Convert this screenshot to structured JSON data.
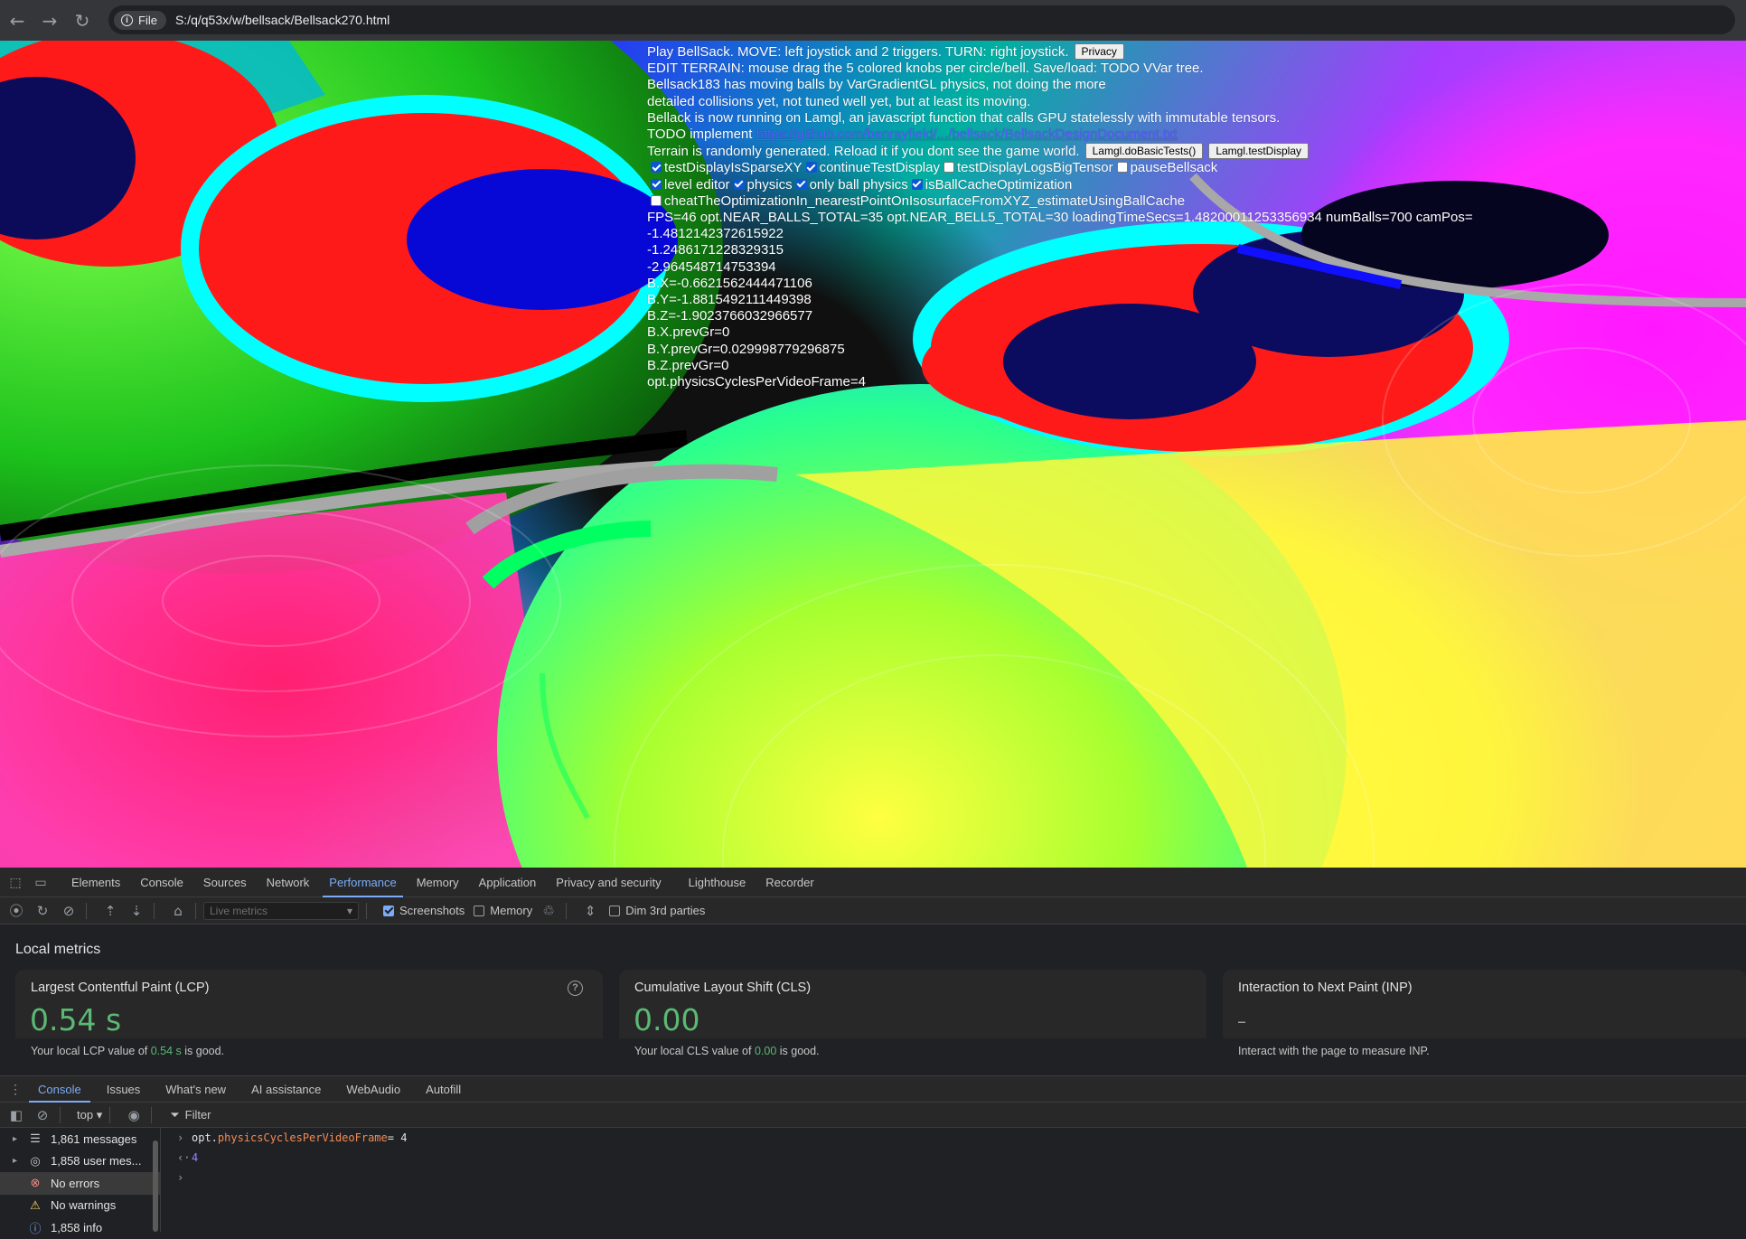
{
  "browser": {
    "back_icon": "back-arrow-icon",
    "forward_icon": "forward-arrow-icon",
    "reload_icon": "reload-icon",
    "chip_label": "File",
    "url": "S:/q/q53x/w/bellsack/Bellsack270.html"
  },
  "game": {
    "line1": "Play BellSack. MOVE: left joystick and 2 triggers. TURN: right joystick.",
    "privacy_button": "Privacy",
    "line2": "EDIT TERRAIN: mouse drag the 5 colored knobs per circle/bell. Save/load: TODO VVar tree.",
    "line3": "Bellsack183 has moving balls by VarGradientGL physics, not doing the more",
    "line4": "detailed collisions yet, not tuned well yet, but at least its moving.",
    "line5": "Bellack is now running on Lamgl, an javascript function that calls GPU statelessly with immutable tensors.",
    "line6_prefix": "TODO implement",
    "line6_link": "https://github.com/benrayfield/.../bellsack/BellsackDesignDocument.txt",
    "line7": "Terrain is randomly generated. Reload it if you dont see the game world.",
    "basic_tests_button": "Lamgl.doBasicTests()",
    "test_display_button": "Lamgl.testDisplay",
    "checkboxes_row1": [
      {
        "label": "testDisplayIsSparseXY",
        "checked": true
      },
      {
        "label": "continueTestDisplay",
        "checked": true
      },
      {
        "label": "testDisplayLogsBigTensor",
        "checked": false
      },
      {
        "label": "pauseBellsack",
        "checked": false
      }
    ],
    "checkboxes_row2": [
      {
        "label": "level editor",
        "checked": true
      },
      {
        "label": "physics",
        "checked": true
      },
      {
        "label": "only ball physics",
        "checked": true
      },
      {
        "label": "isBallCacheOptimization",
        "checked": true
      }
    ],
    "checkbox_row3": {
      "label": "cheatTheOptimizationIn_nearestPointOnIsosurfaceFromXYZ_estimateUsingBallCache",
      "checked": false
    },
    "stats": [
      "FPS=46 opt.NEAR_BALLS_TOTAL=35 opt.NEAR_BELL5_TOTAL=30 loadingTimeSecs=1.48200011253356934 numBalls=700 camPos=",
      "-1.4812142372615922",
      "-1.2486171228329315",
      "-2.964548714753394",
      "B.X=-0.6621562444471106",
      "B.Y=-1.8815492111449398",
      "B.Z=-1.9023766032966577",
      "B.X.prevGr=0",
      "B.Y.prevGr=0.029998779296875",
      "B.Z.prevGr=0",
      "opt.physicsCyclesPerVideoFrame=4"
    ]
  },
  "devtools": {
    "tabs": [
      "Elements",
      "Console",
      "Sources",
      "Network",
      "Performance",
      "Memory",
      "Application",
      "Privacy and security",
      "Lighthouse",
      "Recorder"
    ],
    "active_tab": "Performance",
    "toolbar": {
      "select_placeholder": "Live metrics",
      "screenshots_label": "Screenshots",
      "screenshots_checked": true,
      "memory_label": "Memory",
      "memory_checked": false,
      "dim_label": "Dim 3rd parties",
      "dim_checked": false
    },
    "metrics_title": "Local metrics",
    "cards": [
      {
        "title": "Largest Contentful Paint (LCP)",
        "value": "0.54 s",
        "desc_prefix": "Your local LCP value of ",
        "desc_value": "0.54 s",
        "desc_suffix": " is good."
      },
      {
        "title": "Cumulative Layout Shift (CLS)",
        "value": "0.00",
        "desc_prefix": "Your local CLS value of ",
        "desc_value": "0.00",
        "desc_suffix": " is good."
      },
      {
        "title": "Interaction to Next Paint (INP)",
        "value": "–",
        "desc": "Interact with the page to measure INP."
      }
    ],
    "drawer_tabs": [
      "Console",
      "Issues",
      "What's new",
      "AI assistance",
      "WebAudio",
      "Autofill"
    ],
    "drawer_active": "Console",
    "console_context": "top",
    "filter_label": "Filter",
    "sidebar": [
      {
        "label": "1,861 messages",
        "icon": "list-icon"
      },
      {
        "label": "1,858 user mes...",
        "icon": "user-icon"
      },
      {
        "label": "No errors",
        "icon": "error-icon"
      },
      {
        "label": "No warnings",
        "icon": "warning-icon"
      },
      {
        "label": "1,858 info",
        "icon": "info-icon"
      }
    ],
    "console_lines": {
      "input_object": "opt.",
      "input_prop": "physicsCyclesPerVideoFrame",
      "input_rest": " = 4",
      "result": "4"
    }
  }
}
